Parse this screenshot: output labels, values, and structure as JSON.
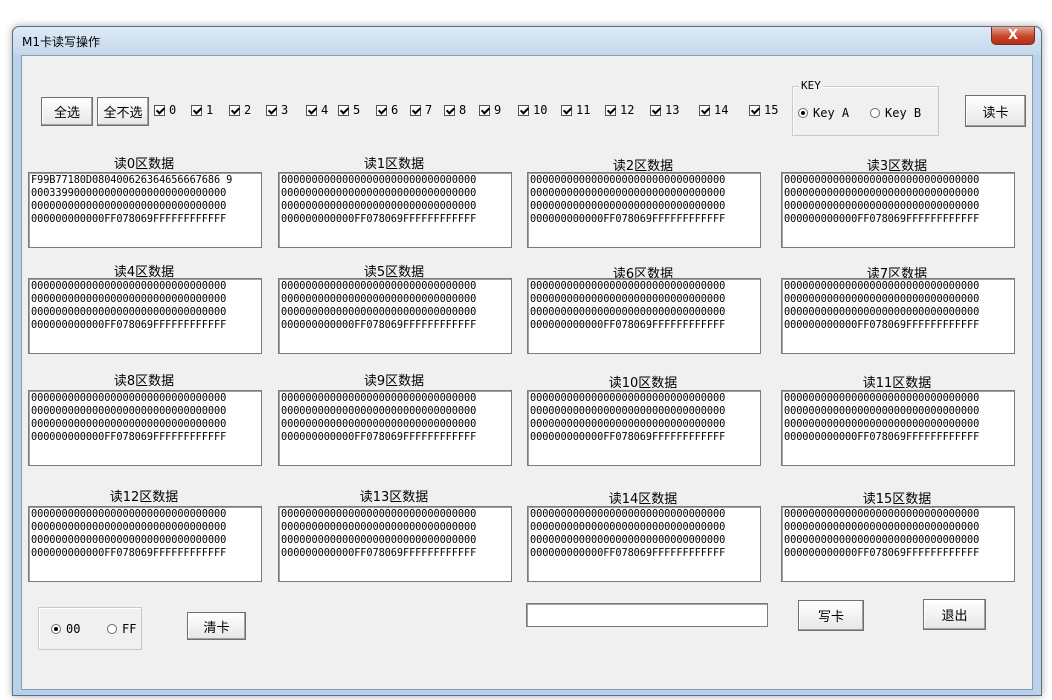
{
  "window": {
    "title": "M1卡读写操作",
    "close_symbol": "X"
  },
  "toolbar": {
    "select_all": "全选",
    "select_none": "全不选",
    "read_card": "读卡"
  },
  "checkboxes": [
    "0",
    "1",
    "2",
    "3",
    "4",
    "5",
    "6",
    "7",
    "8",
    "9",
    "10",
    "11",
    "12",
    "13",
    "14",
    "15"
  ],
  "key_group": {
    "label": "KEY",
    "key_a": "Key A",
    "key_b": "Key B",
    "selected": "Key A"
  },
  "sectors": [
    {
      "label": "读0区数据",
      "lines": [
        "F99B77180D080400626364656667686 9",
        "00033990000000000000000000000000",
        "00000000000000000000000000000000",
        "000000000000FF078069FFFFFFFFFFFF"
      ]
    },
    {
      "label": "读1区数据",
      "lines": [
        "00000000000000000000000000000000",
        "00000000000000000000000000000000",
        "00000000000000000000000000000000",
        "000000000000FF078069FFFFFFFFFFFF"
      ]
    },
    {
      "label": "读2区数据",
      "lines": [
        "00000000000000000000000000000000",
        "00000000000000000000000000000000",
        "00000000000000000000000000000000",
        "000000000000FF078069FFFFFFFFFFFF"
      ]
    },
    {
      "label": "读3区数据",
      "lines": [
        "00000000000000000000000000000000",
        "00000000000000000000000000000000",
        "00000000000000000000000000000000",
        "000000000000FF078069FFFFFFFFFFFF"
      ]
    },
    {
      "label": "读4区数据",
      "lines": [
        "00000000000000000000000000000000",
        "00000000000000000000000000000000",
        "00000000000000000000000000000000",
        "000000000000FF078069FFFFFFFFFFFF"
      ]
    },
    {
      "label": "读5区数据",
      "lines": [
        "00000000000000000000000000000000",
        "00000000000000000000000000000000",
        "00000000000000000000000000000000",
        "000000000000FF078069FFFFFFFFFFFF"
      ]
    },
    {
      "label": "读6区数据",
      "lines": [
        "00000000000000000000000000000000",
        "00000000000000000000000000000000",
        "00000000000000000000000000000000",
        "000000000000FF078069FFFFFFFFFFFF"
      ]
    },
    {
      "label": "读7区数据",
      "lines": [
        "00000000000000000000000000000000",
        "00000000000000000000000000000000",
        "00000000000000000000000000000000",
        "000000000000FF078069FFFFFFFFFFFF"
      ]
    },
    {
      "label": "读8区数据",
      "lines": [
        "00000000000000000000000000000000",
        "00000000000000000000000000000000",
        "00000000000000000000000000000000",
        "000000000000FF078069FFFFFFFFFFFF"
      ]
    },
    {
      "label": "读9区数据",
      "lines": [
        "00000000000000000000000000000000",
        "00000000000000000000000000000000",
        "00000000000000000000000000000000",
        "000000000000FF078069FFFFFFFFFFFF"
      ]
    },
    {
      "label": "读10区数据",
      "lines": [
        "00000000000000000000000000000000",
        "00000000000000000000000000000000",
        "00000000000000000000000000000000",
        "000000000000FF078069FFFFFFFFFFFF"
      ]
    },
    {
      "label": "读11区数据",
      "lines": [
        "00000000000000000000000000000000",
        "00000000000000000000000000000000",
        "00000000000000000000000000000000",
        "000000000000FF078069FFFFFFFFFFFF"
      ]
    },
    {
      "label": "读12区数据",
      "lines": [
        "00000000000000000000000000000000",
        "00000000000000000000000000000000",
        "00000000000000000000000000000000",
        "000000000000FF078069FFFFFFFFFFFF"
      ]
    },
    {
      "label": "读13区数据",
      "lines": [
        "00000000000000000000000000000000",
        "00000000000000000000000000000000",
        "00000000000000000000000000000000",
        "000000000000FF078069FFFFFFFFFFFF"
      ]
    },
    {
      "label": "读14区数据",
      "lines": [
        "00000000000000000000000000000000",
        "00000000000000000000000000000000",
        "00000000000000000000000000000000",
        "000000000000FF078069FFFFFFFFFFFF"
      ]
    },
    {
      "label": "读15区数据",
      "lines": [
        "00000000000000000000000000000000",
        "00000000000000000000000000000000",
        "00000000000000000000000000000000",
        "000000000000FF078069FFFFFFFFFFFF"
      ]
    }
  ],
  "bottom": {
    "fill_00": "00",
    "fill_ff": "FF",
    "fill_selected": "00",
    "clear_card": "清卡",
    "write_input_value": "",
    "write_card": "写卡",
    "exit": "退出"
  }
}
